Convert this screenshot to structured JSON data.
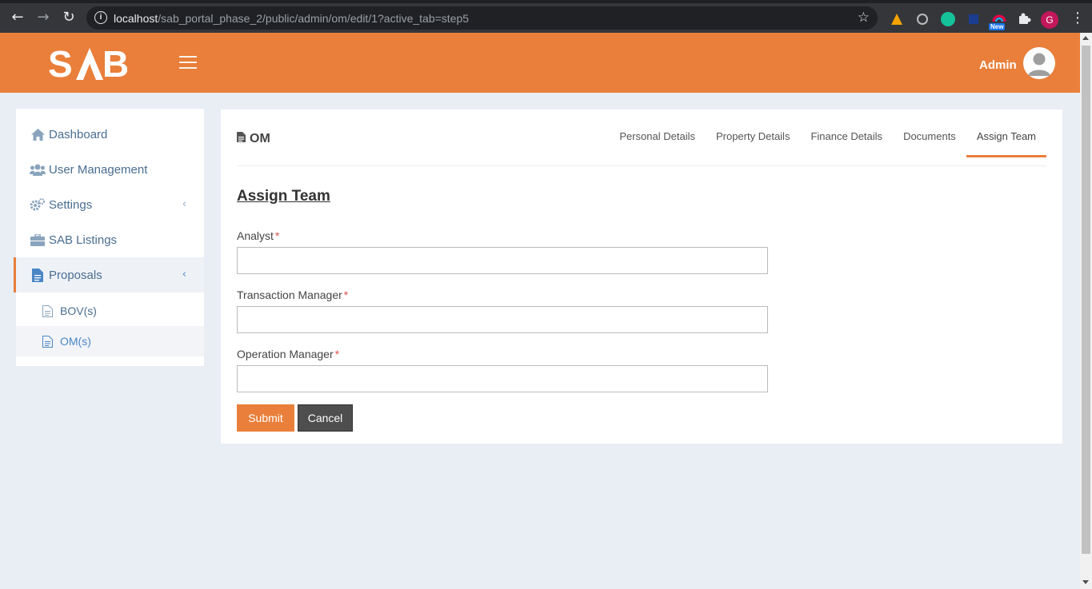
{
  "browser": {
    "url_host": "localhost",
    "url_path": "/sab_portal_phase_2/public/admin/om/edit/1?active_tab=step5",
    "new_badge": "New",
    "profile_initial": "G"
  },
  "header": {
    "logo_text": "SAB",
    "user_label": "Admin",
    "accent_color": "#e97f3a"
  },
  "sidebar": {
    "items": [
      {
        "label": "Dashboard",
        "icon": "home-icon"
      },
      {
        "label": "User Management",
        "icon": "users-icon"
      },
      {
        "label": "Settings",
        "icon": "cogs-icon"
      },
      {
        "label": "SAB Listings",
        "icon": "briefcase-icon"
      },
      {
        "label": "Proposals",
        "icon": "document-icon"
      }
    ],
    "sub_items": [
      {
        "label": "BOV(s)",
        "icon": "file-icon"
      },
      {
        "label": "OM(s)",
        "icon": "file-icon"
      }
    ]
  },
  "main": {
    "title": "OM",
    "tabs": [
      "Personal Details",
      "Property Details",
      "Finance Details",
      "Documents",
      "Assign Team"
    ],
    "active_tab": "Assign Team",
    "section_title": "Assign Team",
    "fields": [
      {
        "label": "Analyst",
        "value": "",
        "required_mark": "*"
      },
      {
        "label": "Transaction Manager",
        "value": "",
        "required_mark": "*"
      },
      {
        "label": "Operation Manager",
        "value": "",
        "required_mark": "*"
      }
    ],
    "submit_label": "Submit",
    "cancel_label": "Cancel"
  }
}
